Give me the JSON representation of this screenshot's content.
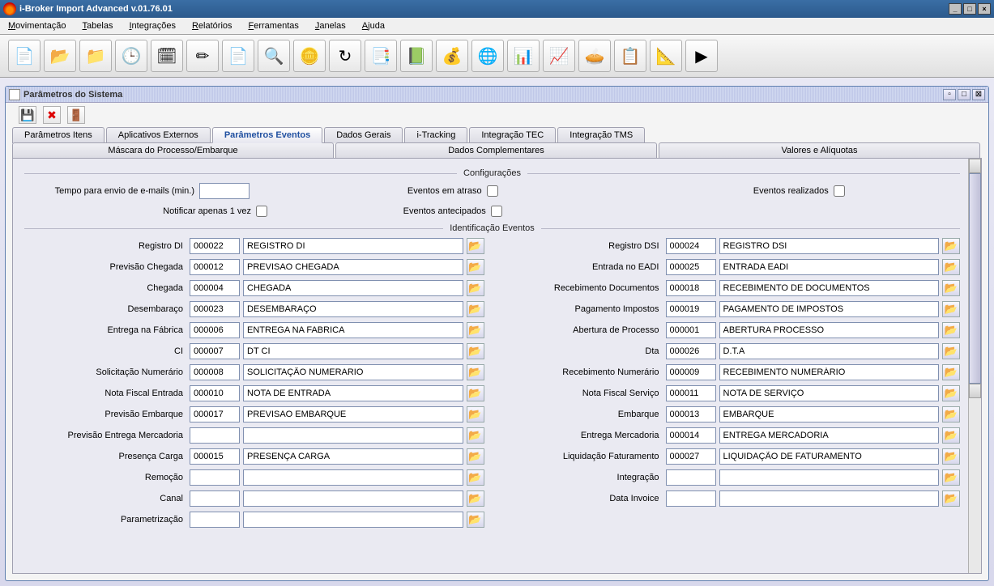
{
  "window": {
    "title": "i-Broker Import Advanced v.01.76.01"
  },
  "menu": [
    "Movimentação",
    "Tabelas",
    "Integrações",
    "Relatórios",
    "Ferramentas",
    "Janelas",
    "Ajuda"
  ],
  "toolbarIcons": [
    "📄",
    "📂",
    "📁",
    "🕒",
    "🗓",
    "✏",
    "📄",
    "🔍",
    "🪙",
    "↻",
    "📑",
    "📗",
    "💰",
    "🌐",
    "📊",
    "📈",
    "🥧",
    "📋",
    "📐",
    "▶"
  ],
  "internal": {
    "title": "Parâmetros do Sistema"
  },
  "tabsTop": [
    "Parâmetros Itens",
    "Aplicativos Externos",
    "Parâmetros Eventos",
    "Dados Gerais",
    "i-Tracking",
    "Integração TEC",
    "Integração TMS"
  ],
  "tabsTopActive": 2,
  "tabsBottom": [
    "Máscara do Processo/Embarque",
    "Dados Complementares",
    "Valores e Alíquotas"
  ],
  "section1": "Configurações",
  "configLabels": {
    "tempo": "Tempo para envio de e-mails (min.)",
    "notificar": "Notificar apenas 1 vez",
    "atraso": "Eventos em atraso",
    "antecipados": "Eventos antecipados",
    "realizados": "Eventos realizados"
  },
  "configValues": {
    "tempo": ""
  },
  "section2": "Identificação Eventos",
  "eventsLeft": [
    {
      "label": "Registro DI",
      "code": "000022",
      "desc": "REGISTRO DI"
    },
    {
      "label": "Previsão Chegada",
      "code": "000012",
      "desc": "PREVISAO CHEGADA"
    },
    {
      "label": "Chegada",
      "code": "000004",
      "desc": "CHEGADA"
    },
    {
      "label": "Desembaraço",
      "code": "000023",
      "desc": "DESEMBARAÇO"
    },
    {
      "label": "Entrega na Fábrica",
      "code": "000006",
      "desc": "ENTREGA NA FABRICA"
    },
    {
      "label": "CI",
      "code": "000007",
      "desc": "DT CI"
    },
    {
      "label": "Solicitação Numerário",
      "code": "000008",
      "desc": "SOLICITAÇÃO NUMERARIO"
    },
    {
      "label": "Nota Fiscal Entrada",
      "code": "000010",
      "desc": "NOTA DE ENTRADA"
    },
    {
      "label": "Previsão Embarque",
      "code": "000017",
      "desc": "PREVISAO EMBARQUE"
    },
    {
      "label": "Previsão Entrega Mercadoria",
      "code": "",
      "desc": ""
    },
    {
      "label": "Presença Carga",
      "code": "000015",
      "desc": "PRESENÇA CARGA"
    },
    {
      "label": "Remoção",
      "code": "",
      "desc": ""
    },
    {
      "label": "Canal",
      "code": "",
      "desc": ""
    },
    {
      "label": "Parametrização",
      "code": "",
      "desc": ""
    }
  ],
  "eventsRight": [
    {
      "label": "Registro DSI",
      "code": "000024",
      "desc": "REGISTRO DSI"
    },
    {
      "label": "Entrada no EADI",
      "code": "000025",
      "desc": "ENTRADA EADI"
    },
    {
      "label": "Recebimento Documentos",
      "code": "000018",
      "desc": "RECEBIMENTO DE DOCUMENTOS"
    },
    {
      "label": "Pagamento Impostos",
      "code": "000019",
      "desc": "PAGAMENTO DE IMPOSTOS"
    },
    {
      "label": "Abertura de Processo",
      "code": "000001",
      "desc": "ABERTURA PROCESSO"
    },
    {
      "label": "Dta",
      "code": "000026",
      "desc": "D.T.A"
    },
    {
      "label": "Recebimento Numerário",
      "code": "000009",
      "desc": "RECEBIMENTO NUMERÁRIO"
    },
    {
      "label": "Nota Fiscal Serviço",
      "code": "000011",
      "desc": "NOTA DE SERVIÇO"
    },
    {
      "label": "Embarque",
      "code": "000013",
      "desc": "EMBARQUE"
    },
    {
      "label": "Entrega Mercadoria",
      "code": "000014",
      "desc": "ENTREGA MERCADORIA"
    },
    {
      "label": "Liquidação Faturamento",
      "code": "000027",
      "desc": "LIQUIDAÇÃO DE FATURAMENTO"
    },
    {
      "label": "Integração",
      "code": "",
      "desc": ""
    },
    {
      "label": "Data Invoice",
      "code": "",
      "desc": ""
    }
  ]
}
